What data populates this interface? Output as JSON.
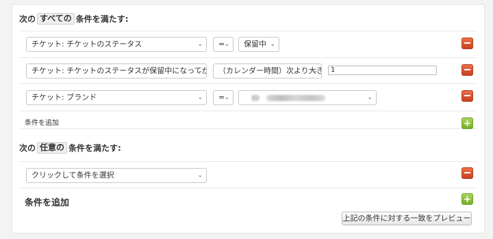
{
  "all_section": {
    "prefix": "次の",
    "keyword": "すべての",
    "suffix": "条件を満たす:",
    "conditions": [
      {
        "field": "チケット: チケットのステータス",
        "operator": "=",
        "value": "保留中"
      },
      {
        "field": "チケット: チケットのステータスが保留中になってからの時",
        "operator": "（カレンダー時間）次より大きい",
        "value": "1"
      },
      {
        "field": "チケット: ブランド",
        "operator": "=",
        "value": ""
      }
    ],
    "add_label": "条件を追加"
  },
  "any_section": {
    "prefix": "次の",
    "keyword": "任意の",
    "suffix": "条件を満たす:",
    "conditions": [
      {
        "field": "クリックして条件を選択"
      }
    ],
    "add_label": "条件を追加"
  },
  "preview_button": "上記の条件に対する一致をプレビュー",
  "icons": {
    "remove": "minus-icon",
    "add": "plus-icon",
    "dropdown": "chevron-down-icon"
  },
  "colors": {
    "remove": "#d9532c",
    "add": "#8cc13f"
  }
}
